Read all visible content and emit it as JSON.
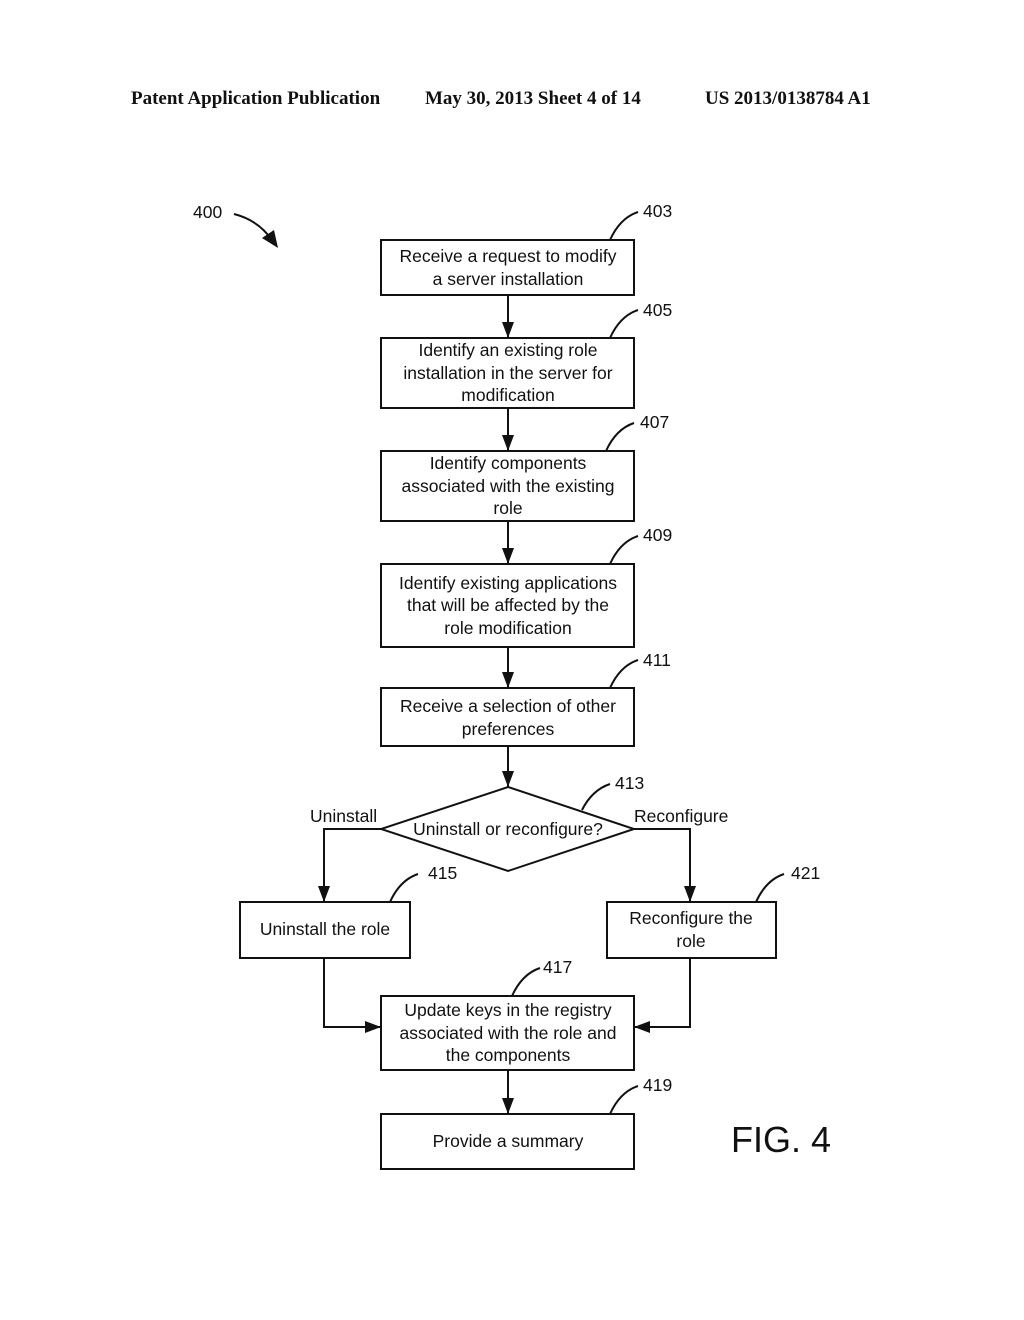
{
  "header": {
    "publication": "Patent Application Publication",
    "date_sheet": "May 30, 2013  Sheet 4 of 14",
    "patent_number": "US 2013/0138784 A1"
  },
  "figure": {
    "ref": "400",
    "label": "FIG. 4"
  },
  "steps": [
    {
      "ref": "403",
      "lines": [
        "Receive a request to modify",
        "a server installation"
      ]
    },
    {
      "ref": "405",
      "lines": [
        "Identify an existing role",
        "installation in the server for",
        "modification"
      ]
    },
    {
      "ref": "407",
      "lines": [
        "Identify components",
        "associated with the existing",
        "role"
      ]
    },
    {
      "ref": "409",
      "lines": [
        "Identify existing applications",
        "that will be affected by the",
        "role modification"
      ]
    },
    {
      "ref": "411",
      "lines": [
        "Receive a selection of other",
        "preferences"
      ]
    },
    {
      "ref": "415",
      "lines": [
        "Uninstall the role"
      ]
    },
    {
      "ref": "421",
      "lines": [
        "Reconfigure the",
        "role"
      ]
    },
    {
      "ref": "417",
      "lines": [
        "Update keys in the registry",
        "associated with the role and",
        "the components"
      ]
    },
    {
      "ref": "419",
      "lines": [
        "Provide a summary"
      ]
    }
  ],
  "decision": {
    "ref": "413",
    "text": "Uninstall or reconfigure?",
    "left_branch": "Uninstall",
    "right_branch": "Reconfigure"
  }
}
